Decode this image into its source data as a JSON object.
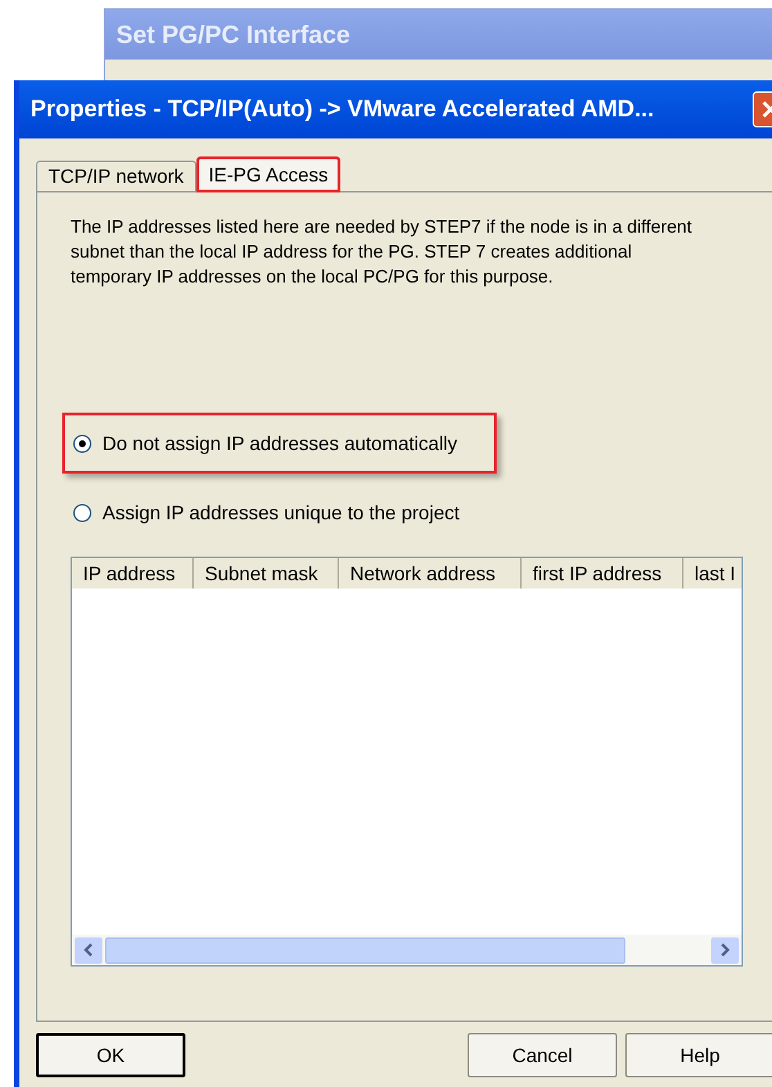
{
  "background_window": {
    "title": "Set PG/PC Interface"
  },
  "dialog": {
    "title": "Properties - TCP/IP(Auto) -> VMware Accelerated AMD..."
  },
  "tabs": [
    {
      "label": "TCP/IP network",
      "selected": false,
      "highlighted": false
    },
    {
      "label": "IE-PG Access",
      "selected": true,
      "highlighted": true
    }
  ],
  "description": "The IP addresses listed here are needed by STEP7 if the node is in a different subnet than the local IP address for the PG. STEP 7 creates additional temporary IP addresses on the local PC/PG for this purpose.",
  "options": [
    {
      "label": "Do not assign IP addresses automatically",
      "selected": true,
      "highlighted": true
    },
    {
      "label": "Assign IP addresses unique to the project",
      "selected": false,
      "highlighted": false
    }
  ],
  "table": {
    "columns": [
      "IP address",
      "Subnet mask",
      "Network address",
      "first IP address",
      "last I"
    ]
  },
  "buttons": [
    {
      "label": "OK",
      "default": true
    },
    {
      "label": "Cancel",
      "default": false
    },
    {
      "label": "Help",
      "default": false
    }
  ]
}
